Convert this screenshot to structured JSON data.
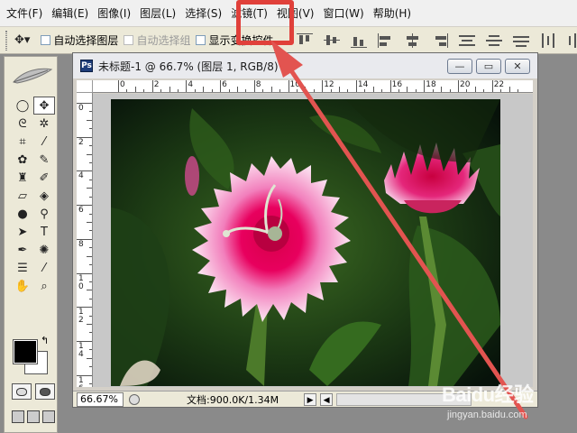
{
  "menubar": {
    "items": [
      "文件(F)",
      "编辑(E)",
      "图像(I)",
      "图层(L)",
      "选择(S)",
      "滤镜(T)",
      "视图(V)",
      "窗口(W)",
      "帮助(H)"
    ]
  },
  "options_bar": {
    "auto_select_layer": "自动选择图层",
    "auto_select_group": "自动选择组",
    "show_transform_controls": "显示变换控件"
  },
  "document": {
    "title": "未标题-1 @ 66.7% (图层 1, RGB/8)",
    "min_label": "—",
    "max_label": "▭",
    "close_label": "✕",
    "ruler_h_labels": [
      "0",
      "2",
      "4",
      "6",
      "8",
      "10",
      "12",
      "14",
      "16",
      "18",
      "20",
      "22"
    ],
    "ruler_v_labels": [
      "0",
      "2",
      "4",
      "6",
      "8",
      "1\n0",
      "1\n2",
      "1\n4",
      "1\n6"
    ],
    "zoom": "66.67%",
    "doc_info": "文档:900.0K/1.34M"
  },
  "icons": {
    "move_tool": "move-tool-icon",
    "feather": "photoshop-feather-icon",
    "ps_doc": "photoshop-document-icon"
  },
  "colors": {
    "annotation": "#e0403a",
    "foreground": "#000000",
    "background": "#ffffff"
  },
  "watermark": {
    "logo": "Baidu经验",
    "url": "jingyan.baidu.com"
  }
}
